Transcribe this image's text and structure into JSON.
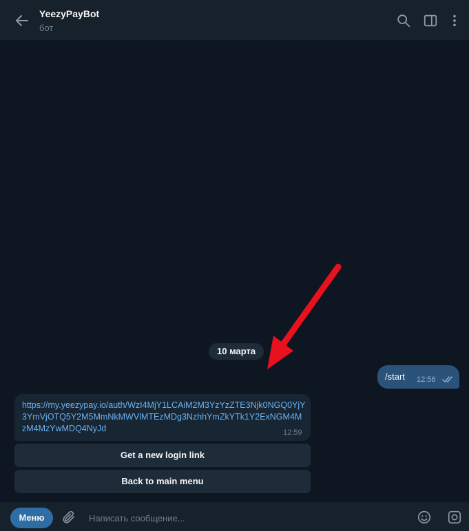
{
  "header": {
    "title": "YeezyPayBot",
    "subtitle": "бот",
    "icons": [
      "back-arrow-icon",
      "search-icon",
      "sidebar-toggle-icon",
      "more-vertical-icon"
    ]
  },
  "chat": {
    "date_label": "10 марта",
    "outgoing": {
      "text": "/start",
      "time": "12:56",
      "status": "read"
    },
    "incoming": {
      "link": "https://my.yeezypay.io/auth/WzI4MjY1LCAiM2M3YzYzZTE3Njk0NGQ0YjY3YmVjOTQ5Y2M5MmNkMWVlMTEzMDg3NzhhYmZkYTk1Y2ExNGM4MzM4MzYwMDQ4NyJd",
      "time": "12:59"
    },
    "keyboard": [
      "Get a new login link",
      "Back to main menu"
    ]
  },
  "composer": {
    "menu_label": "Меню",
    "placeholder": "Написать сообщение..."
  },
  "colors": {
    "background": "#0e1621",
    "header": "#17212b",
    "outgoing_bubble": "#2b5278",
    "incoming_bubble": "#182533",
    "link": "#6ab2f2",
    "accent": "#2f6ea5",
    "annotation_arrow": "#e8111d"
  }
}
